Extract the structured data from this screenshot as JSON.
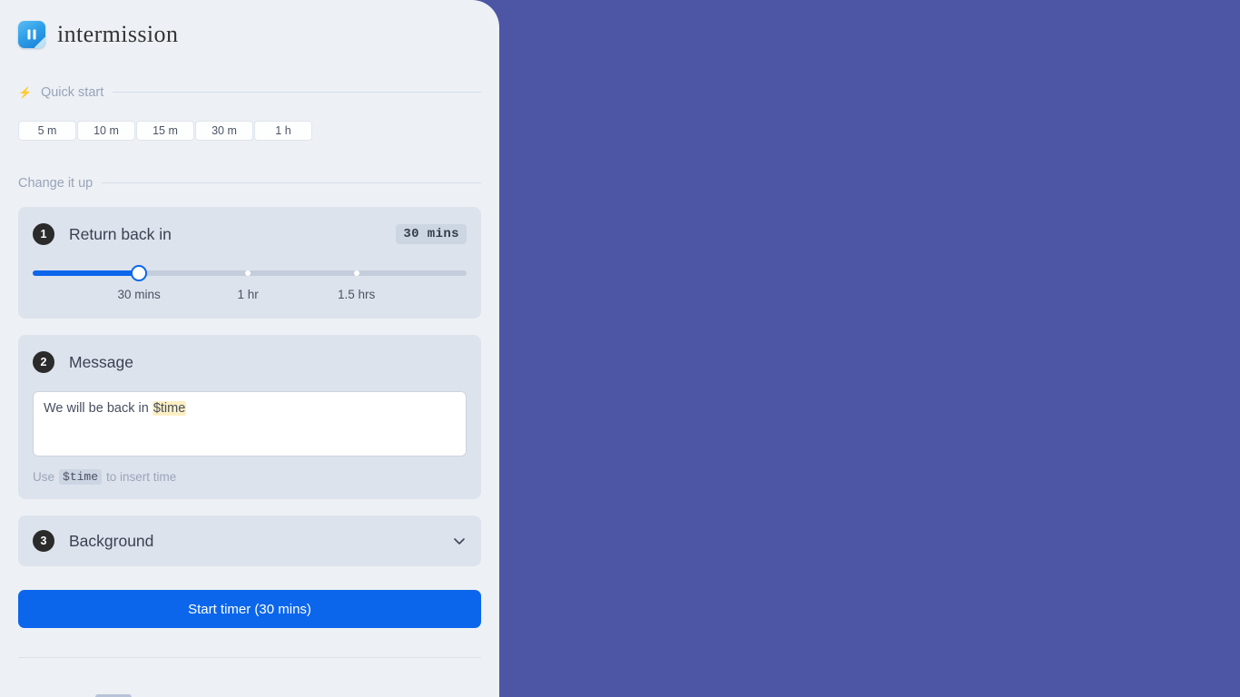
{
  "app": {
    "name": "intermission",
    "logo_icon": "pause-logo-icon",
    "panel_bg": "#edf1f5",
    "desktop_bg": "#4d55a5",
    "accent": "#0b66ec"
  },
  "quick_start": {
    "icon": "lightning-bolt-icon",
    "label": "Quick start",
    "options": [
      {
        "label": "5 m"
      },
      {
        "label": "10 m"
      },
      {
        "label": "15 m"
      },
      {
        "label": "30 m"
      },
      {
        "label": "1 h"
      }
    ]
  },
  "change_it_up": {
    "label": "Change it up"
  },
  "steps": {
    "return_back": {
      "number": "1",
      "title": "Return back in",
      "value_badge": "30 mins",
      "slider": {
        "fill_percent": 24.5,
        "thumb_percent": 24.5,
        "ticks": [
          {
            "label": "30 mins",
            "percent": 24.5
          },
          {
            "label": "1 hr",
            "percent": 49.6
          },
          {
            "label": "1.5 hrs",
            "percent": 74.6
          }
        ]
      }
    },
    "message": {
      "number": "2",
      "title": "Message",
      "value_prefix": "We will be back in ",
      "value_token": "$time",
      "hint_prefix": "Use",
      "hint_token": "$time",
      "hint_suffix": "to insert time"
    },
    "background": {
      "number": "3",
      "title": "Background",
      "chevron_icon": "chevron-down-icon"
    }
  },
  "actions": {
    "start_timer": "Start timer (30 mins)"
  }
}
